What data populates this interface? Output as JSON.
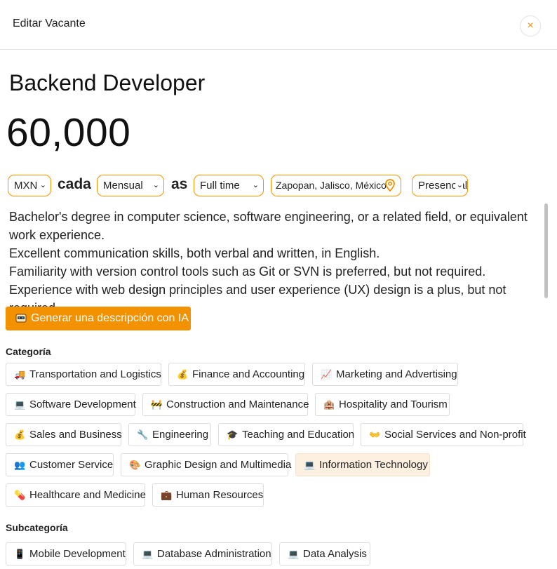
{
  "header": {
    "title": "Editar Vacante",
    "close_glyph": "×"
  },
  "job": {
    "title": "Backend Developer",
    "salary": "60,000"
  },
  "controls": {
    "currency": "MXN",
    "word_cada": "cada",
    "period": "Mensual",
    "word_as": "as",
    "employment_type": "Full time",
    "location": "Zapopan, Jalisco, México",
    "modality": "Presencial"
  },
  "description": [
    "Bachelor's degree in computer science, software engineering, or a related field, or equivalent work experience.",
    "Excellent communication skills, both verbal and written, in English.",
    "Familiarity with version control tools such as Git or SVN is preferred, but not required.",
    "Experience with web design principles and user experience (UX) design is a plus, but not required."
  ],
  "ai_button": {
    "label": "Generar una descripción con IA",
    "icon": "robot-icon"
  },
  "categoria": {
    "label": "Categoría",
    "items": [
      {
        "label": "Transportation and Logistics",
        "icon": "truck-icon",
        "glyph": "🚚",
        "selected": false
      },
      {
        "label": "Finance and Accounting",
        "icon": "money-bag-icon",
        "glyph": "💰",
        "selected": false
      },
      {
        "label": "Marketing and Advertising",
        "icon": "chart-up-icon",
        "glyph": "📈",
        "selected": false
      },
      {
        "label": "Software Development",
        "icon": "computer-icon",
        "glyph": "💻",
        "selected": false
      },
      {
        "label": "Construction and Maintenance",
        "icon": "construction-icon",
        "glyph": "🚧",
        "selected": false
      },
      {
        "label": "Hospitality and Tourism",
        "icon": "hotel-icon",
        "glyph": "🏨",
        "selected": false
      },
      {
        "label": "Sales and Business",
        "icon": "money-bag-icon",
        "glyph": "💰",
        "selected": false
      },
      {
        "label": "Engineering",
        "icon": "wrench-icon",
        "glyph": "🔧",
        "selected": false
      },
      {
        "label": "Teaching and Education",
        "icon": "graduation-cap-icon",
        "glyph": "🎓",
        "selected": false
      },
      {
        "label": "Social Services and Non-profit",
        "icon": "open-hands-icon",
        "glyph": "👐",
        "selected": false
      },
      {
        "label": "Customer Service",
        "icon": "people-icon",
        "glyph": "👥",
        "selected": false
      },
      {
        "label": "Graphic Design and Multimedia",
        "icon": "palette-icon",
        "glyph": "🎨",
        "selected": false
      },
      {
        "label": "Information Technology",
        "icon": "computer-icon",
        "glyph": "💻",
        "selected": true
      },
      {
        "label": "Healthcare and Medicine",
        "icon": "pill-icon",
        "glyph": "💊",
        "selected": false
      },
      {
        "label": "Human Resources",
        "icon": "briefcase-icon",
        "glyph": "💼",
        "selected": false
      }
    ]
  },
  "subcategoria": {
    "label": "Subcategoría",
    "items": [
      {
        "label": "Mobile Development",
        "icon": "mobile-phone-icon",
        "glyph": "📱",
        "selected": false
      },
      {
        "label": "Database Administration",
        "icon": "computer-icon",
        "glyph": "💻",
        "selected": false
      },
      {
        "label": "Data Analysis",
        "icon": "computer-icon",
        "glyph": "💻",
        "selected": false
      }
    ]
  },
  "colors": {
    "accent": "#f39200",
    "selected_chip_bg": "#fdf0e0"
  }
}
